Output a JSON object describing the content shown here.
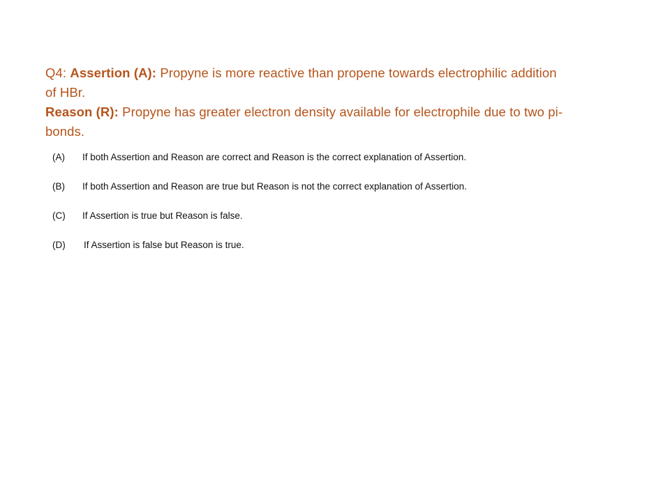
{
  "question": {
    "number": "Q4: ",
    "assertion_label": "Assertion (A):",
    "assertion_text_line1": " Propyne is more reactive than propene towards electrophilic addition",
    "assertion_text_line2": "of HBr.",
    "reason_label": "Reason (R):",
    "reason_text_line1": " Propyne has greater electron density available for electrophile due to two pi-",
    "reason_text_line2": "bonds."
  },
  "options": [
    {
      "letter": "(A)",
      "text": "If both Assertion and Reason are correct and Reason is the correct explanation of Assertion."
    },
    {
      "letter": "(B)",
      "text": "If both Assertion and Reason are true but Reason is not the correct explanation of Assertion."
    },
    {
      "letter": "(C)",
      "text": "If Assertion is true but Reason is false."
    },
    {
      "letter": "(D)",
      "text": "If Assertion is false but Reason is true."
    }
  ],
  "colors": {
    "question_text": "#b5541b",
    "option_text": "#111111",
    "background": "#ffffff"
  }
}
